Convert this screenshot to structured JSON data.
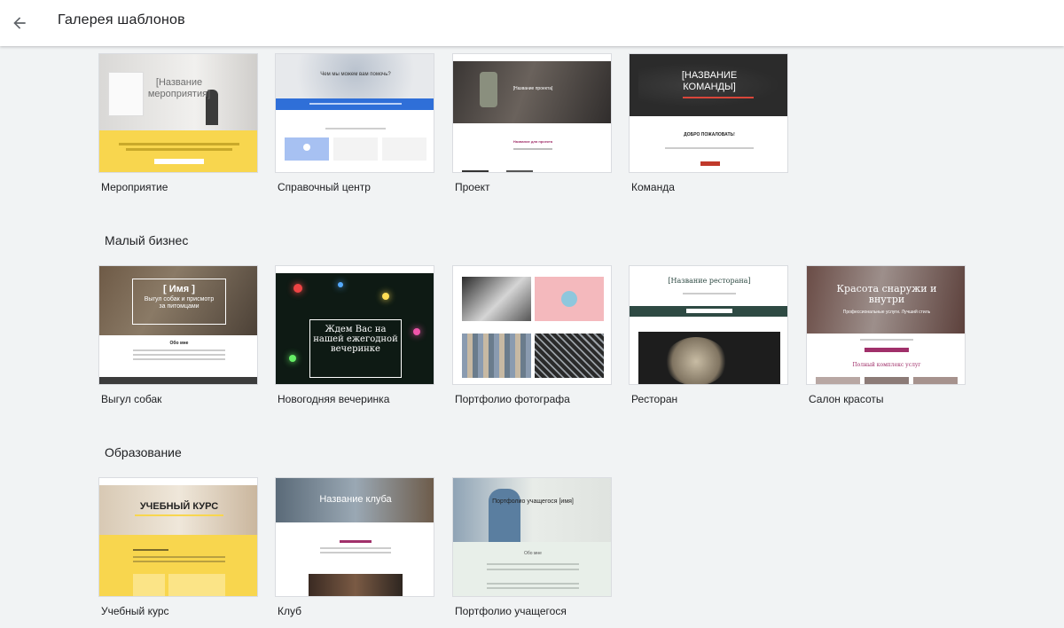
{
  "header": {
    "title": "Галерея шаблонов",
    "back_icon": "arrow-back-icon"
  },
  "sections": [
    {
      "title": ""
    },
    {
      "title": "Малый бизнес"
    },
    {
      "title": "Образование"
    }
  ],
  "templates": {
    "event": {
      "label": "Мероприятие",
      "thumb_title": "[Название мероприятия]"
    },
    "help_center": {
      "label": "Справочный центр",
      "thumb_title": "Чем мы можем вам помочь?"
    },
    "project": {
      "label": "Проект",
      "thumb_title": "[Название проекта]",
      "thumb_sub": "Название для проекта"
    },
    "team": {
      "label": "Команда",
      "thumb_title": "[НАЗВАНИЕ КОМАНДЫ]",
      "thumb_sub": "ДОБРО ПОЖАЛОВАТЬ!"
    },
    "dog_walking": {
      "label": "Выгул собак",
      "thumb_title": "[ Имя ]",
      "thumb_sub": "Выгул собак и присмотр за питомцами",
      "thumb_about": "Обо мне"
    },
    "new_year": {
      "label": "Новогодняя вечеринка",
      "thumb_title": "Ждем Вас на нашей ежегодной вечеринке"
    },
    "photo_portfolio": {
      "label": "Портфолио фотографа"
    },
    "restaurant": {
      "label": "Ресторан",
      "thumb_title": "[Название ресторана]"
    },
    "beauty_salon": {
      "label": "Салон красоты",
      "thumb_title": "Красота снаружи и внутри",
      "thumb_sub": "Профессиональные услуги. Лучший стиль",
      "thumb_services": "Полный комплекс услуг"
    },
    "course": {
      "label": "Учебный курс",
      "thumb_title": "УЧЕБНЫЙ КУРС"
    },
    "club": {
      "label": "Клуб",
      "thumb_title": "Название клуба"
    },
    "student_portfolio": {
      "label": "Портфолио учащегося",
      "thumb_title": "Портфолио учащегося [имя]",
      "thumb_about": "Обо мне"
    }
  },
  "colors": {
    "page_bg": "#f1f3f4",
    "event_yellow": "#f8d64e",
    "help_blue": "#2f6fd8",
    "team_red": "#c0392b",
    "restaurant_green": "#2e4a43",
    "beauty_pink": "#a0306a",
    "course_yellow": "#f8d64e"
  }
}
